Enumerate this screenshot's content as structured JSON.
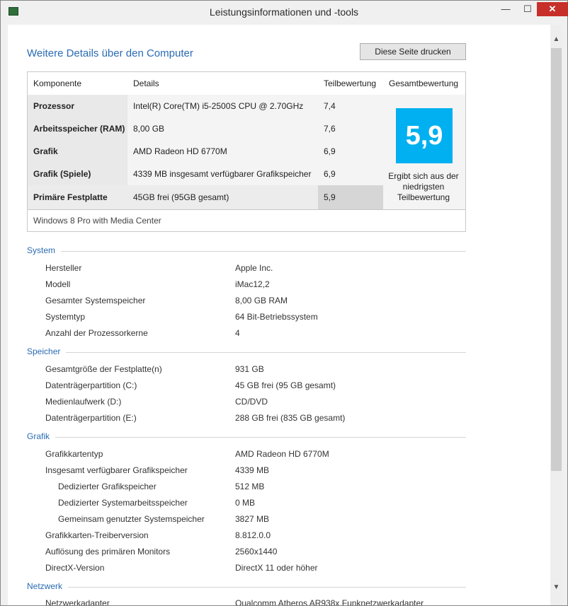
{
  "window": {
    "title": "Leistungsinformationen und -tools",
    "minimize_glyph": "—",
    "maximize_glyph": "☐",
    "close_glyph": "✕",
    "scroll_up_glyph": "▲",
    "scroll_down_glyph": "▼"
  },
  "page": {
    "heading": "Weitere Details über den Computer",
    "print_button": "Diese Seite drucken"
  },
  "score_table": {
    "headers": [
      "Komponente",
      "Details",
      "Teilbewertung",
      "Gesamtbewertung"
    ],
    "rows": [
      {
        "component": "Prozessor",
        "details": "Intel(R) Core(TM) i5-2500S CPU @ 2.70GHz",
        "subscore": "7,4"
      },
      {
        "component": "Arbeitsspeicher (RAM)",
        "details": "8,00 GB",
        "subscore": "7,6"
      },
      {
        "component": "Grafik",
        "details": "AMD Radeon HD 6770M",
        "subscore": "6,9"
      },
      {
        "component": "Grafik (Spiele)",
        "details": "4339 MB insgesamt verfügbarer Grafikspeicher",
        "subscore": "6,9"
      },
      {
        "component": "Primäre Festplatte",
        "details": "45GB frei (95GB gesamt)",
        "subscore": "5,9"
      }
    ],
    "overall_score": "5,9",
    "overall_caption": "Ergibt sich aus der niedrigsten Teilbewertung",
    "os": "Windows 8 Pro with Media Center"
  },
  "sections": {
    "system": {
      "title": "System",
      "items": [
        {
          "key": "Hersteller",
          "value": "Apple Inc."
        },
        {
          "key": "Modell",
          "value": "iMac12,2"
        },
        {
          "key": "Gesamter Systemspeicher",
          "value": "8,00 GB RAM"
        },
        {
          "key": "Systemtyp",
          "value": "64 Bit-Betriebssystem"
        },
        {
          "key": "Anzahl der Prozessorkerne",
          "value": "4"
        }
      ]
    },
    "storage": {
      "title": "Speicher",
      "items": [
        {
          "key": "Gesamtgröße der Festplatte(n)",
          "value": "931 GB"
        },
        {
          "key": "Datenträgerpartition (C:)",
          "value": "45 GB frei (95 GB gesamt)"
        },
        {
          "key": "Medienlaufwerk (D:)",
          "value": "CD/DVD"
        },
        {
          "key": "Datenträgerpartition (E:)",
          "value": "288 GB frei (835 GB gesamt)"
        }
      ]
    },
    "graphics": {
      "title": "Grafik",
      "items": [
        {
          "key": "Grafikkartentyp",
          "value": "AMD Radeon HD 6770M"
        },
        {
          "key": "Insgesamt verfügbarer Grafikspeicher",
          "value": "4339 MB"
        },
        {
          "key": "Dedizierter Grafikspeicher",
          "value": "512 MB"
        },
        {
          "key": "Dedizierter Systemarbeitsspeicher",
          "value": "0 MB"
        },
        {
          "key": "Gemeinsam genutzter Systemspeicher",
          "value": "3827 MB"
        },
        {
          "key": "Grafikkarten-Treiberversion",
          "value": "8.812.0.0"
        },
        {
          "key": "Auflösung des primären Monitors",
          "value": "2560x1440"
        },
        {
          "key": "DirectX-Version",
          "value": "DirectX 11 oder höher"
        }
      ]
    },
    "network": {
      "title": "Netzwerk",
      "items": [
        {
          "key": "Netzwerkadapter",
          "value": "Qualcomm Atheros AR938x Funknetzwerkadapter"
        }
      ]
    }
  }
}
